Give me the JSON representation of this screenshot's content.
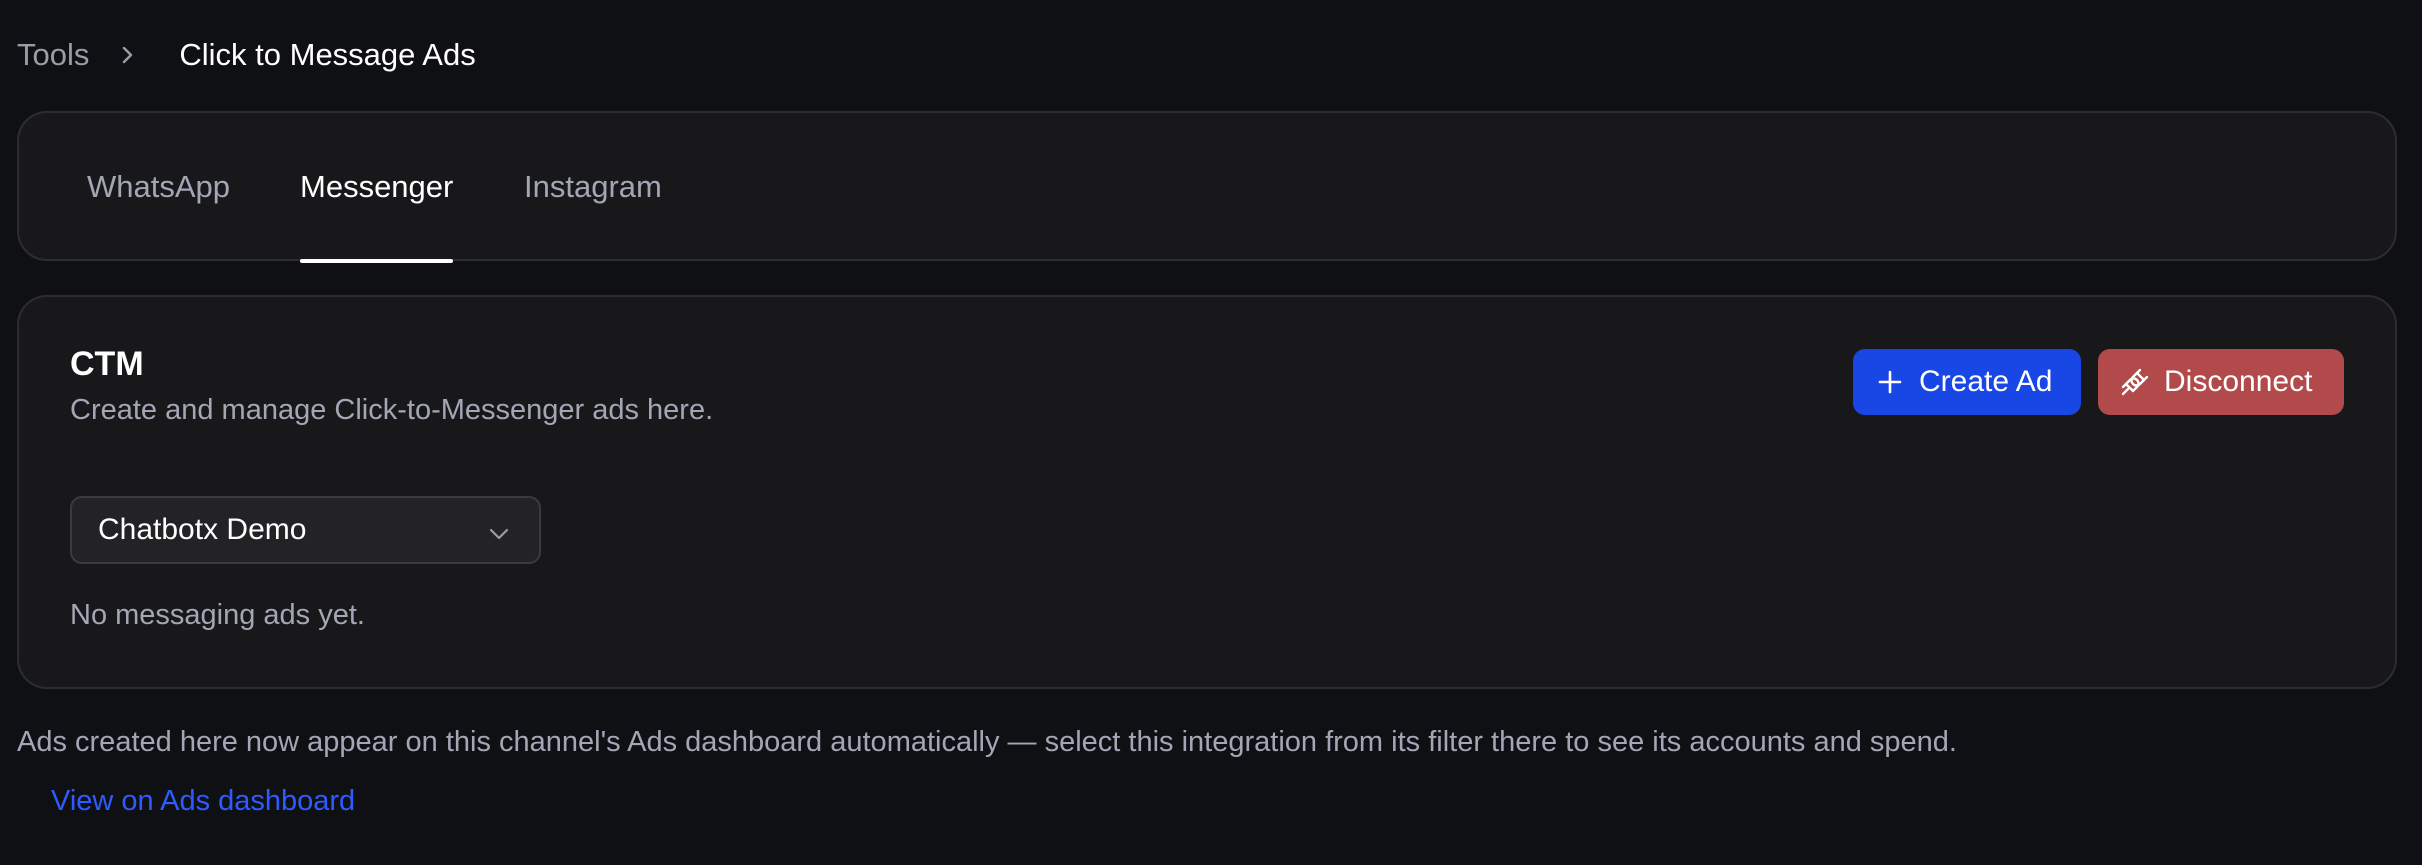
{
  "breadcrumb": {
    "root": "Tools",
    "separator_icon": "chevron-right-icon",
    "current": "Click to Message Ads"
  },
  "tabs": [
    {
      "label": "WhatsApp",
      "active": false
    },
    {
      "label": "Messenger",
      "active": true
    },
    {
      "label": "Instagram",
      "active": false
    }
  ],
  "card": {
    "title": "CTM",
    "subtitle": "Create and manage Click-to-Messenger ads here.",
    "create_button": {
      "label": "Create Ad",
      "icon": "plus-icon",
      "color": "#1947e5"
    },
    "disconnect_button": {
      "label": "Disconnect",
      "icon": "unplug-icon",
      "color": "#b24a4c"
    },
    "account_select": {
      "value": "Chatbotx Demo",
      "icon": "chevron-down-icon"
    },
    "empty_state": "No messaging ads yet."
  },
  "footer": {
    "note": "Ads created here now appear on this channel's Ads dashboard automatically — select this integration from its filter there to see its accounts and spend.",
    "link_label": "View on Ads dashboard",
    "link_color": "#2e5bff"
  },
  "colors": {
    "background": "#0f1014",
    "card_background": "#18181b",
    "card_border": "#2c2d33",
    "muted_text": "#a3a6b4"
  }
}
